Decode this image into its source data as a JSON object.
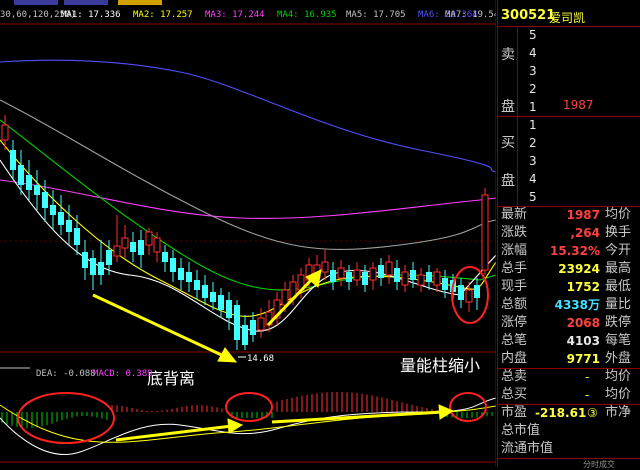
{
  "top_tabs": [
    "...",
    "...",
    "..."
  ],
  "ma_bar": {
    "params": "30,60,120,250)",
    "ma1": "MA1: 17.336",
    "ma2": "MA2: 17.257",
    "ma3": "MA3: 17.244",
    "ma4": "MA4: 16.935",
    "ma5": "MA5: 17.705",
    "ma6": "MA6: 20.364",
    "ma7": "MA7: 19.540"
  },
  "macd_bar": {
    "dea": "DEA: -0.088",
    "macd": "MACD: 0.389"
  },
  "price_low_label": "14.68",
  "annotations": {
    "bottom_divergence": "底背离",
    "volume_shrink": "量能柱缩小"
  },
  "colors": {
    "up": "#ff3030",
    "down": "#40ffff",
    "arrow": "#ffff00",
    "circle": "#ff2020",
    "ma_white": "#ffffff",
    "ma_yellow": "#ffff00",
    "ma_magenta": "#ff40ff",
    "ma_green": "#00d000",
    "ma_blue": "#5050ff",
    "ma_gray": "#a0a0a0"
  },
  "quote": {
    "code": "300521",
    "name": "爱司凯",
    "sell_label_top": "卖",
    "sell_label_bot": "盘",
    "buy_label_top": "买",
    "buy_label_bot": "盘",
    "sell_levels": [
      "5",
      "4",
      "3",
      "2",
      "1"
    ],
    "sell1_volume": "1987",
    "buy_levels": [
      "1",
      "2",
      "3",
      "4",
      "5"
    ],
    "stats": [
      {
        "l1": "最新",
        "v1": "1987",
        "l2": "均价"
      },
      {
        "l1": "涨跌",
        "v1": ",264",
        "l2": "换手"
      },
      {
        "l1": "涨幅",
        "v1": "15.32%",
        "l2": "今开"
      },
      {
        "l1": "总手",
        "v1": "23924",
        "l2": "最高"
      },
      {
        "l1": "现手",
        "v1": "1752",
        "l2": "最低"
      },
      {
        "l1": "总额",
        "v1": "4338万",
        "l2": "量比"
      },
      {
        "l1": "涨停",
        "v1": "2068",
        "l2": "跌停"
      },
      {
        "l1": "总笔",
        "v1": "4103",
        "l2": "每笔"
      },
      {
        "l1": "内盘",
        "v1": "9771",
        "l2": "外盘"
      }
    ],
    "total_sell_label": "总卖",
    "total_sell_val": "-",
    "total_sell_r": "均价",
    "total_buy_label": "总买",
    "total_buy_val": "-",
    "total_buy_r": "均价",
    "pe_label": "市盈",
    "pe_val": "-218.61",
    "pe_mark": "③",
    "pe_r": "市净",
    "mcap_label": "总市值",
    "float_mcap_label": "流通市值",
    "bottom_tab": "分时成交"
  },
  "chart_data": {
    "type": "candlestick",
    "visible_labels": [
      "14.68"
    ],
    "note_values": {
      "ma1": 17.336,
      "ma2": 17.257,
      "ma3": 17.244,
      "ma4": 16.935,
      "ma5": 17.705,
      "ma6": 20.364,
      "ma7": 19.54,
      "dea": -0.088,
      "macd": 0.389
    }
  }
}
